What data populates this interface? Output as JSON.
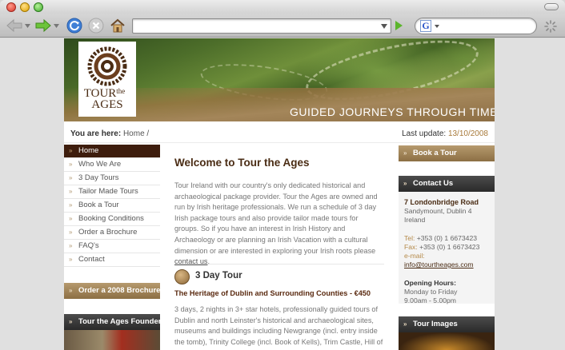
{
  "browser": {
    "url": "",
    "search_placeholder": "",
    "search_engine": "G"
  },
  "header": {
    "logo_line1": "TOUR",
    "logo_small": "the",
    "logo_line2": "AGES",
    "tagline": "GUIDED JOURNEYS THROUGH TIME"
  },
  "breadcrumb": {
    "label": "You are here:",
    "path": "Home /"
  },
  "last_update": {
    "label": "Last update:",
    "date": "13/10/2008"
  },
  "nav": {
    "items": [
      {
        "label": "Home"
      },
      {
        "label": "Who We Are"
      },
      {
        "label": "3 Day Tours"
      },
      {
        "label": "Tailor Made Tours"
      },
      {
        "label": "Book a Tour"
      },
      {
        "label": "Booking Conditions"
      },
      {
        "label": "Order a Brochure"
      },
      {
        "label": "FAQ's"
      },
      {
        "label": "Contact"
      }
    ],
    "order_brochure": "Order a 2008 Brochure",
    "founder": "Tour the Ages Founder"
  },
  "main": {
    "title": "Welcome to Tour the Ages",
    "intro_text": "Tour Ireland with our country's only dedicated historical and archaeological package provider. Tour the Ages are owned and run by Irish heritage professionals. We run a schedule of 3 day Irish package tours and also provide tailor made tours for groups. So if you have an interest in Irish History and Archaeology or are planning an Irish Vacation with a cultural dimension or are interested in exploring your Irish roots please",
    "contact_link": "contact us",
    "intro_end": ".",
    "tour_title": "3 Day Tour",
    "tour_subtitle": "The Heritage of Dublin and Surrounding Counties - €450",
    "tour_lines": [
      "3 days, 2 nights in 3+ star hotels, professionally guided tours of",
      "Dublin and north Leinster's historical and archaeological sites,",
      "museums and buildings including Newgrange (incl. entry inside",
      "the tomb), Trinity College (incl. Book of Kells), Trim Castle, Hill of"
    ]
  },
  "right": {
    "book_tour": "Book a Tour",
    "contact_title": "Contact Us",
    "address_line1": "7 Londonbridge Road",
    "address_line2": "Sandymount, Dublin 4",
    "address_line3": "Ireland",
    "tel_label": "Tel:",
    "tel": "+353 (0) 1 6673423",
    "fax_label": "Fax:",
    "fax": "+353 (0) 1 6673423",
    "email_label": "e-mail:",
    "email": "info@tourtheages.com",
    "hours_title": "Opening Hours:",
    "hours_days": "Monday to Friday",
    "hours_time": "9.00am - 5.00pm",
    "images_title": "Tour Images"
  },
  "colors": {
    "brown": "#4a2c14",
    "nav_active": "#3e1d0d",
    "gold": "#a87a3a"
  }
}
